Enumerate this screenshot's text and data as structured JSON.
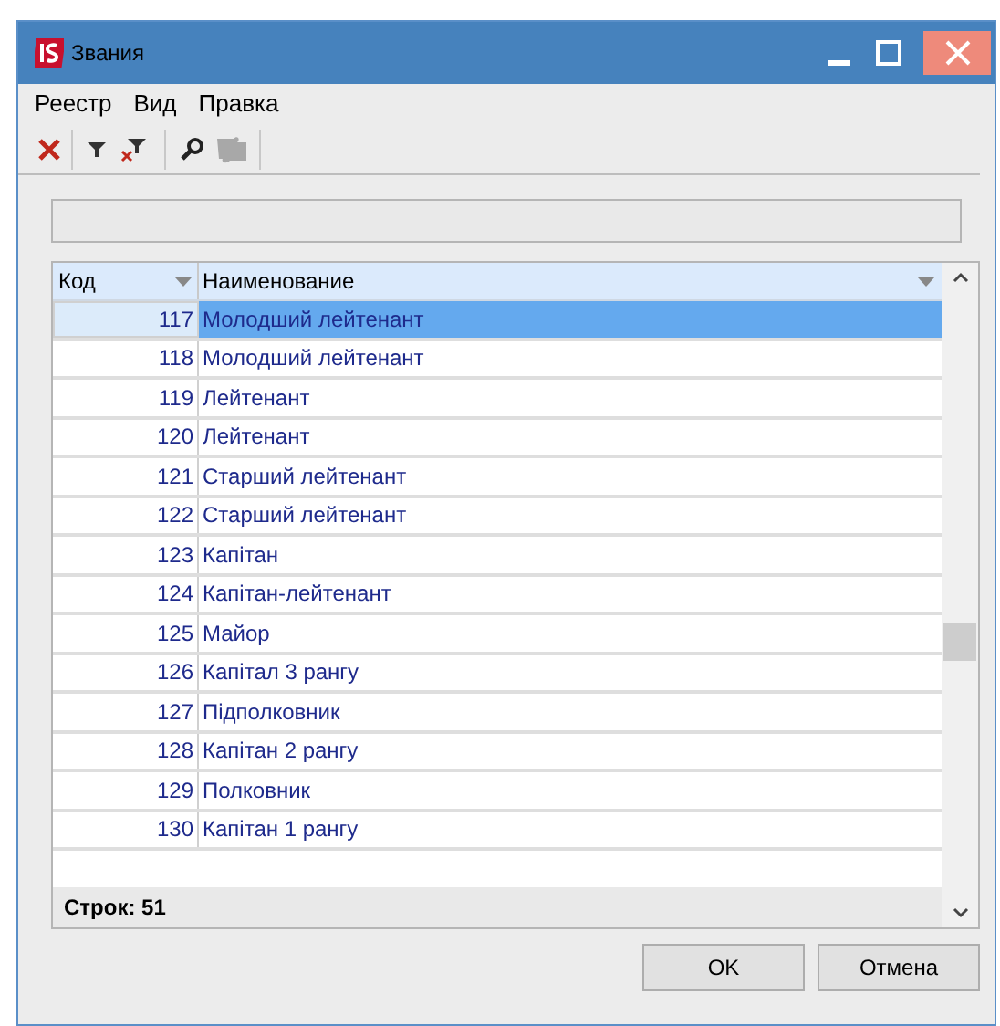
{
  "window": {
    "title": "Звания"
  },
  "menu": [
    "Реестр",
    "Вид",
    "Правка"
  ],
  "table": {
    "columns": [
      "Код",
      "Наименование"
    ],
    "rows": [
      {
        "code": "117",
        "name": "Молодший лейтенант",
        "selected": true
      },
      {
        "code": "118",
        "name": "Молодший лейтенант",
        "selected": false
      },
      {
        "code": "119",
        "name": "Лейтенант",
        "selected": false
      },
      {
        "code": "120",
        "name": "Лейтенант",
        "selected": false
      },
      {
        "code": "121",
        "name": "Старший лейтенант",
        "selected": false
      },
      {
        "code": "122",
        "name": "Старший лейтенант",
        "selected": false
      },
      {
        "code": "123",
        "name": "Капітан",
        "selected": false
      },
      {
        "code": "124",
        "name": "Капітан-лейтенант",
        "selected": false
      },
      {
        "code": "125",
        "name": "Майор",
        "selected": false
      },
      {
        "code": "126",
        "name": "Капітал 3 рангу",
        "selected": false
      },
      {
        "code": "127",
        "name": "Підполковник",
        "selected": false
      },
      {
        "code": "128",
        "name": "Капітан 2 рангу",
        "selected": false
      },
      {
        "code": "129",
        "name": "Полковник",
        "selected": false
      },
      {
        "code": "130",
        "name": "Капітан 1 рангу",
        "selected": false
      }
    ],
    "footer": "Строк: 51"
  },
  "buttons": [
    "OK",
    "Отмена"
  ]
}
